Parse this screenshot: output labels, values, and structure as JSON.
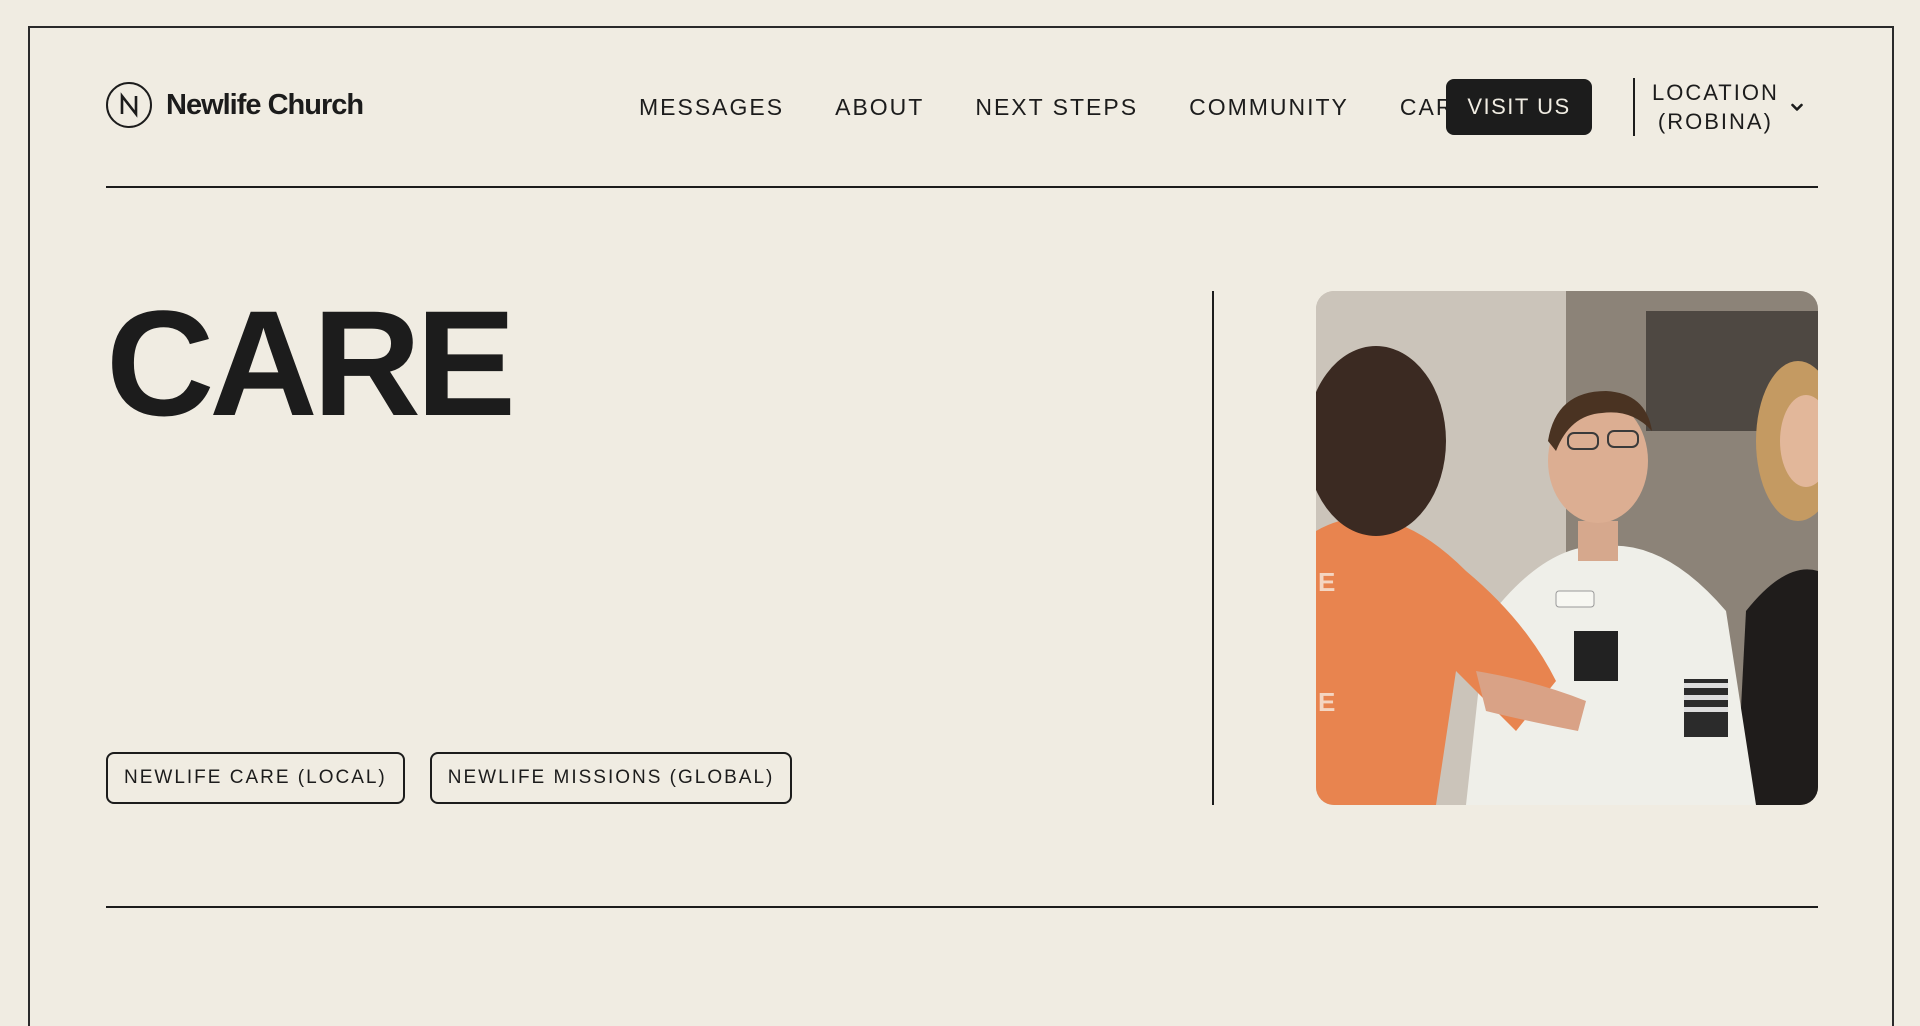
{
  "header": {
    "logo_letter": "N",
    "logo_text": "Newlife Church",
    "nav": [
      {
        "label": "MESSAGES"
      },
      {
        "label": "ABOUT"
      },
      {
        "label": "NEXT STEPS"
      },
      {
        "label": "COMMUNITY"
      },
      {
        "label": "CARE"
      }
    ],
    "visit_label": "VISIT US",
    "location_line1": "LOCATION",
    "location_line2": "(ROBINA)"
  },
  "hero": {
    "title": "CARE",
    "tags": [
      {
        "label": "NEWLIFE CARE (LOCAL)"
      },
      {
        "label": "NEWLIFE MISSIONS (GLOBAL)"
      }
    ]
  },
  "colors": {
    "background": "#f0ece2",
    "ink": "#1c1c1c",
    "shirt_orange": "#e8844f"
  },
  "icons": [
    "logo-n-icon",
    "chevron-down-icon"
  ]
}
